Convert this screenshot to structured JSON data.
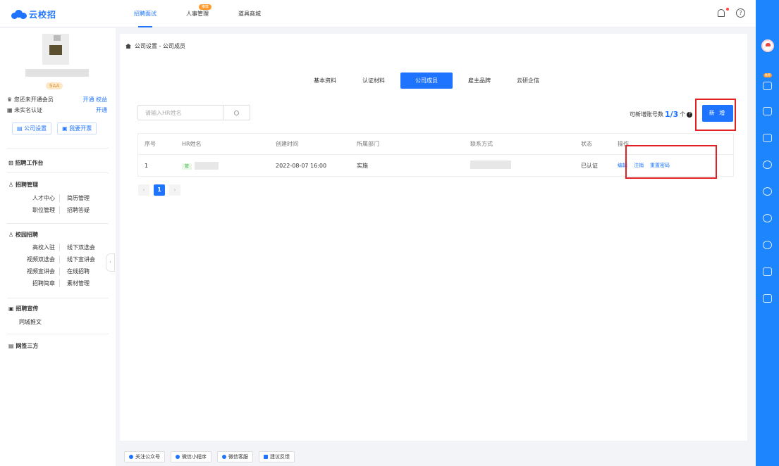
{
  "app": {
    "logo_text": "云校招"
  },
  "topnav": {
    "tabs": [
      {
        "label": "招聘面试",
        "active": true
      },
      {
        "label": "人事管理",
        "badge": "推荐"
      },
      {
        "label": "道具商城"
      }
    ]
  },
  "sidebar": {
    "level_badge": "SAA",
    "member_text": "您还未开通会员",
    "member_open": "开通",
    "member_rights": "权益",
    "verify_text": "未实名认证",
    "verify_open": "开通",
    "company_settings": "公司设置",
    "invoice": "我要开票",
    "workbench": "招聘工作台",
    "recruit_mgmt": "招聘管理",
    "recruit_items": [
      "人才中心",
      "简历管理",
      "职位管理",
      "招聘答疑"
    ],
    "campus": "校园招聘",
    "campus_items": [
      "高校入驻",
      "线下双选会",
      "视频双选会",
      "线下宣讲会",
      "视频宣讲会",
      "在线招聘",
      "招聘简章",
      "素材管理"
    ],
    "promo": "招聘宣传",
    "promo_items": [
      "同城推文"
    ],
    "sign": "网签三方"
  },
  "main": {
    "breadcrumb": "公司设置 - 公司成员",
    "tabs": [
      {
        "label": "基本资料"
      },
      {
        "label": "认证材料"
      },
      {
        "label": "公司成员",
        "active": true
      },
      {
        "label": "雇主品牌"
      },
      {
        "label": "云研企信"
      }
    ],
    "search_placeholder": "请输入HR姓名",
    "quota_label": "可新增账号数",
    "quota_value": "1/3",
    "quota_unit": "个",
    "quota_help": "?",
    "add_button": "新 增",
    "table": {
      "headers": [
        "序号",
        "HR姓名",
        "创建时间",
        "所属部门",
        "联系方式",
        "状态",
        "操作"
      ],
      "rows": [
        {
          "index": "1",
          "tag": "管",
          "created": "2022-08-07 16:00",
          "dept": "实施",
          "status": "已认证",
          "ops": [
            "编辑",
            "注销",
            "重置密码"
          ]
        }
      ]
    },
    "pagination": {
      "prev": "‹",
      "current": "1",
      "next": "›"
    }
  },
  "footer": {
    "items": [
      "关注公众号",
      "微信小程序",
      "微信客服",
      "建议反馈"
    ]
  },
  "colors": {
    "accent": "#1e74ff",
    "highlight_box": "#e22222"
  }
}
